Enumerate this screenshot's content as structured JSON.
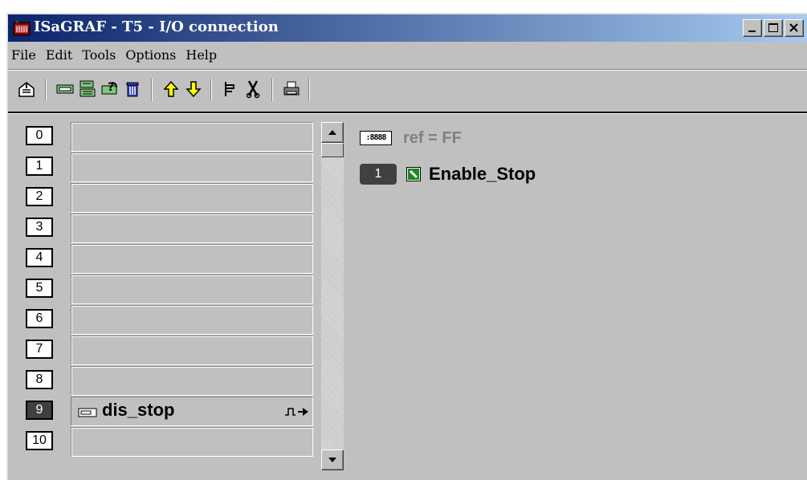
{
  "window": {
    "title": "ISaGRAF - T5 - I/O connection",
    "controls": [
      "minimize",
      "maximize",
      "close"
    ]
  },
  "menu": [
    {
      "label": "File"
    },
    {
      "label": "Edit"
    },
    {
      "label": "Tools"
    },
    {
      "label": "Options"
    },
    {
      "label": "Help"
    }
  ],
  "toolbar": [
    {
      "name": "open-icon"
    },
    {
      "name": "board-icon"
    },
    {
      "name": "board-settings-icon"
    },
    {
      "name": "replace-board-icon"
    },
    {
      "name": "delete-icon"
    },
    {
      "name": "move-up-icon"
    },
    {
      "name": "move-down-icon"
    },
    {
      "name": "connect-icon"
    },
    {
      "name": "disconnect-icon"
    },
    {
      "name": "print-icon"
    }
  ],
  "slots": [
    {
      "num": "0",
      "board": ""
    },
    {
      "num": "1",
      "board": ""
    },
    {
      "num": "2",
      "board": ""
    },
    {
      "num": "3",
      "board": ""
    },
    {
      "num": "4",
      "board": ""
    },
    {
      "num": "5",
      "board": ""
    },
    {
      "num": "6",
      "board": ""
    },
    {
      "num": "7",
      "board": ""
    },
    {
      "num": "8",
      "board": ""
    },
    {
      "num": "9",
      "board": "dis_stop",
      "selected": true
    },
    {
      "num": "10",
      "board": ""
    }
  ],
  "detail": {
    "ref_icon": ":8888",
    "ref_label": "ref = FF",
    "channel_num": "1",
    "channel_name": "Enable_Stop"
  },
  "colors": {
    "title_start": "#0a246a",
    "title_end": "#a6caf0",
    "face": "#c0c0c0",
    "selected_slot": "#404040",
    "ref_text": "#808080",
    "channel_icon": "#1a8a1a"
  }
}
